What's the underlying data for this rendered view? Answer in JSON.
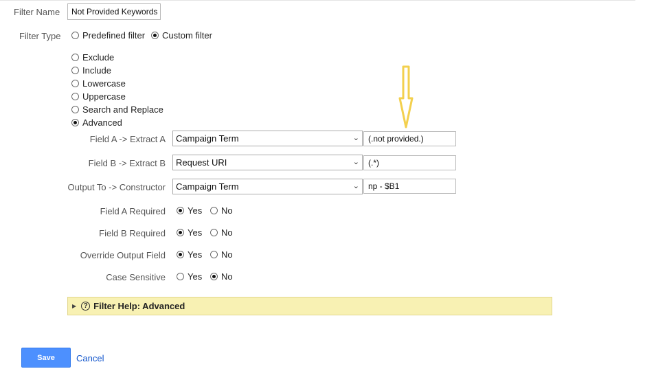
{
  "filter_name": {
    "label": "Filter Name",
    "value": "Not Provided Keywords"
  },
  "filter_type": {
    "label": "Filter Type",
    "options": [
      {
        "label": "Predefined filter",
        "checked": false
      },
      {
        "label": "Custom filter",
        "checked": true
      }
    ]
  },
  "custom_options": [
    {
      "label": "Exclude",
      "checked": false
    },
    {
      "label": "Include",
      "checked": false
    },
    {
      "label": "Lowercase",
      "checked": false
    },
    {
      "label": "Uppercase",
      "checked": false
    },
    {
      "label": "Search and Replace",
      "checked": false
    },
    {
      "label": "Advanced",
      "checked": true
    }
  ],
  "fields": [
    {
      "label": "Field A -> Extract A",
      "select": "Campaign Term",
      "value": "(.not provided.)"
    },
    {
      "label": "Field B -> Extract B",
      "select": "Request URI",
      "value": "(.*)"
    },
    {
      "label": "Output To -> Constructor",
      "select": "Campaign Term",
      "value": "np - $B1"
    }
  ],
  "yes_no": [
    {
      "label": "Field A Required",
      "yes": "Yes",
      "no": "No",
      "selected": "yes"
    },
    {
      "label": "Field B Required",
      "yes": "Yes",
      "no": "No",
      "selected": "yes"
    },
    {
      "label": "Override Output Field",
      "yes": "Yes",
      "no": "No",
      "selected": "yes"
    },
    {
      "label": "Case Sensitive",
      "yes": "Yes",
      "no": "No",
      "selected": "no"
    }
  ],
  "help": {
    "label": "Filter Help: Advanced",
    "q": "?"
  },
  "actions": {
    "save": "Save",
    "cancel": "Cancel"
  },
  "icons": {
    "select_caret": "chevron-down-icon",
    "help_toggle": "triangle-right-icon",
    "help": "question-circle-icon",
    "annotation": "arrow-down-icon"
  },
  "colors": {
    "annotation_arrow": "#f3d04e",
    "help_bg": "#f8f1b3",
    "save_bg": "#4d90fe",
    "link": "#1155cc"
  }
}
